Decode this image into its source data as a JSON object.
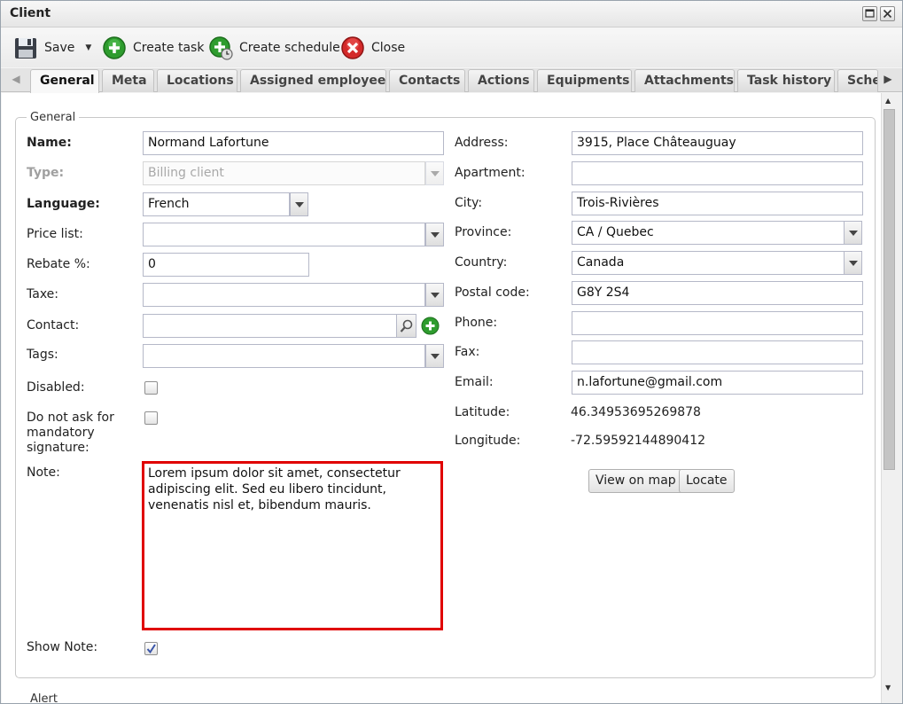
{
  "window": {
    "title": "Client"
  },
  "toolbar": {
    "save": "Save",
    "create_task": "Create task",
    "create_schedule": "Create schedule",
    "close": "Close"
  },
  "tabs": [
    {
      "label": "General",
      "active": true
    },
    {
      "label": "Meta"
    },
    {
      "label": "Locations"
    },
    {
      "label": "Assigned employees"
    },
    {
      "label": "Contacts"
    },
    {
      "label": "Actions"
    },
    {
      "label": "Equipments"
    },
    {
      "label": "Attachments"
    },
    {
      "label": "Task history"
    },
    {
      "label": "Sche"
    }
  ],
  "general": {
    "legend": "General",
    "name": {
      "label": "Name:",
      "value": "Normand Lafortune"
    },
    "type": {
      "label": "Type:",
      "value": "Billing client"
    },
    "language": {
      "label": "Language:",
      "value": "French"
    },
    "price_list": {
      "label": "Price list:",
      "value": ""
    },
    "rebate": {
      "label": "Rebate %:",
      "value": "0"
    },
    "taxe": {
      "label": "Taxe:",
      "value": ""
    },
    "contact": {
      "label": "Contact:",
      "value": ""
    },
    "tags": {
      "label": "Tags:",
      "value": ""
    },
    "disabled": {
      "label": "Disabled:",
      "checked": false
    },
    "mandatory_signature": {
      "label_1": "Do not ask for",
      "label_2": "mandatory",
      "label_3": "signature:",
      "checked": false
    },
    "note": {
      "label": "Note:",
      "value": "Lorem ipsum dolor sit amet, consectetur adipiscing elit. Sed eu libero tincidunt, venenatis nisl et, bibendum mauris."
    },
    "show_note": {
      "label": "Show Note:",
      "checked": true
    },
    "address": {
      "label": "Address:",
      "value": "3915, Place Châteauguay"
    },
    "apartment": {
      "label": "Apartment:",
      "value": ""
    },
    "city": {
      "label": "City:",
      "value": "Trois-Rivières"
    },
    "province": {
      "label": "Province:",
      "value": "CA / Quebec"
    },
    "country": {
      "label": "Country:",
      "value": "Canada"
    },
    "postal_code": {
      "label": "Postal code:",
      "value": "G8Y 2S4"
    },
    "phone": {
      "label": "Phone:",
      "value": ""
    },
    "fax": {
      "label": "Fax:",
      "value": ""
    },
    "email": {
      "label": "Email:",
      "value": "n.lafortune@gmail.com"
    },
    "latitude": {
      "label": "Latitude:",
      "value": "46.34953695269878"
    },
    "longitude": {
      "label": "Longitude:",
      "value": "-72.59592144890412"
    },
    "view_on_map": "View on map",
    "locate": "Locate"
  },
  "alert_legend": "Alert",
  "colors": {
    "note_highlight": "#e00000",
    "accent_green": "#2e9c2e",
    "close_red": "#d42a2a"
  }
}
